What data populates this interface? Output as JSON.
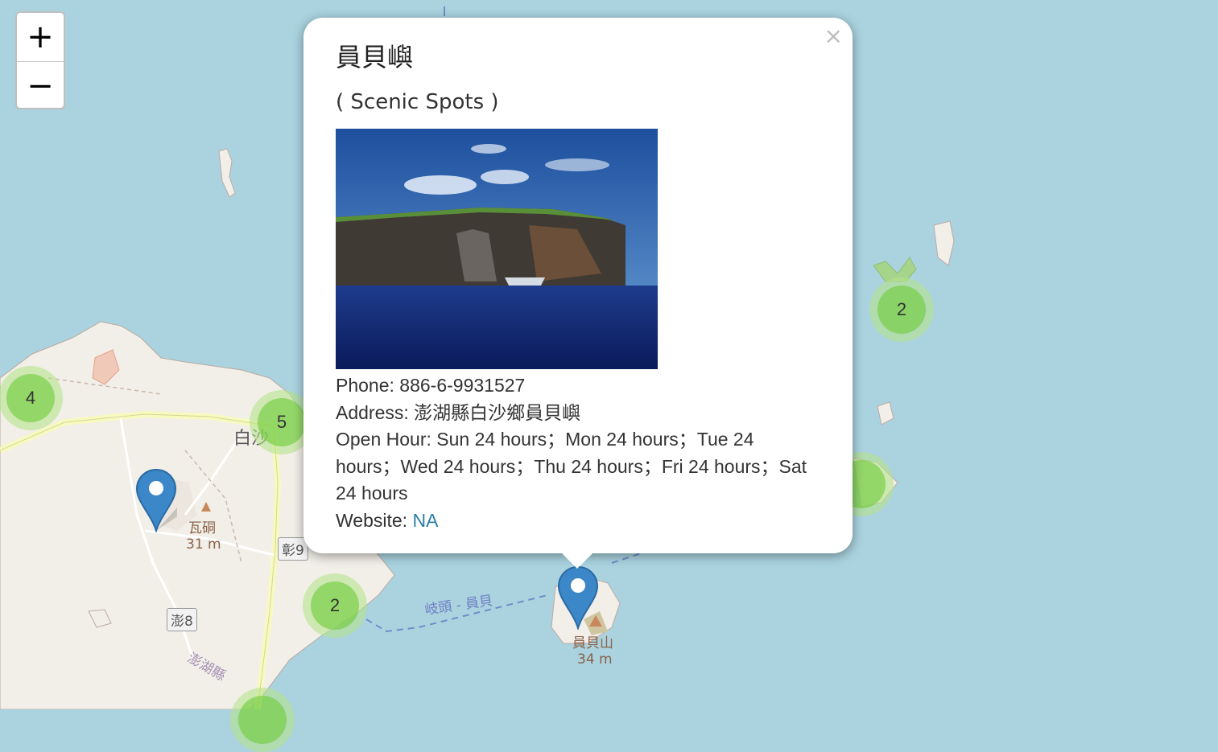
{
  "map": {
    "zoom_in_label": "+",
    "zoom_out_label": "−",
    "clusters": [
      {
        "count": "4"
      },
      {
        "count": "5"
      },
      {
        "count": "2"
      },
      {
        "count": "2"
      }
    ],
    "labels": {
      "peak_wadong": "瓦硐",
      "peak_wadong_elev": "31 m",
      "peak_yuanbei": "員貝山",
      "peak_yuanbei_elev": "34 m",
      "township_baisha": "白沙",
      "road_chang9": "彰9",
      "road_peng8": "澎8",
      "ferry_route": "岐頭 - 員貝",
      "county": "澎湖縣"
    },
    "colors": {
      "sea": "#aad3df",
      "land": "#f2efe9",
      "marker": "#3b87c7"
    }
  },
  "popup": {
    "title": "員貝嶼",
    "category": "( Scenic Spots )",
    "close_label": "×",
    "phone_label": "Phone: ",
    "phone": "886-6-9931527",
    "address_label": "Address: ",
    "address": "澎湖縣白沙鄉員貝嶼",
    "open_hour_label": "Open Hour: ",
    "open_hour": "Sun 24 hours；Mon 24 hours；Tue 24 hours；Wed 24 hours；Thu 24 hours；Fri 24 hours；Sat 24 hours",
    "website_label": "Website: ",
    "website": "NA"
  }
}
